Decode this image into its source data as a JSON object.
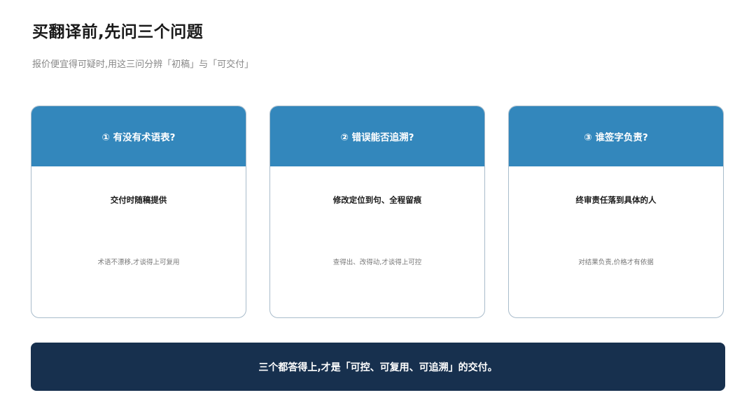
{
  "header": {
    "title": "买翻译前,先问三个问题",
    "subtitle": "报价便宜得可疑时,用这三问分辨「初稿」与「可交付」"
  },
  "cards": [
    {
      "heading": "① 有没有术语表?",
      "main": "交付时随稿提供",
      "note": "术语不漂移,才谈得上可复用"
    },
    {
      "heading": "② 错误能否追溯?",
      "main": "修改定位到句、全程留痕",
      "note": "查得出、改得动,才谈得上可控"
    },
    {
      "heading": "③ 谁签字负责?",
      "main": "终审责任落到具体的人",
      "note": "对结果负责,价格才有依据"
    }
  ],
  "banner": {
    "text": "三个都答得上,才是「可控、可复用、可追溯」的交付。"
  },
  "colors": {
    "card_header": "#3387bc",
    "card_border": "#a9bccb",
    "banner_bg": "#17304e"
  }
}
